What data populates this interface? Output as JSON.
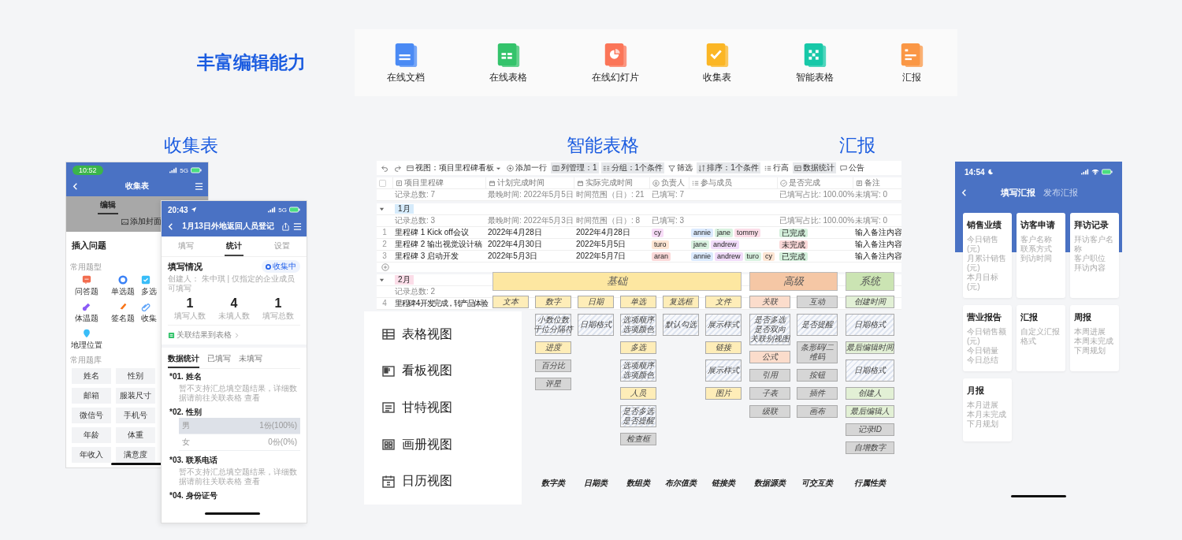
{
  "headline": "丰富编辑能力",
  "apps": [
    {
      "label": "在线文档",
      "kind": "doc"
    },
    {
      "label": "在线表格",
      "kind": "sheet"
    },
    {
      "label": "在线幻灯片",
      "kind": "slide"
    },
    {
      "label": "收集表",
      "kind": "form"
    },
    {
      "label": "智能表格",
      "kind": "smart"
    },
    {
      "label": "汇报",
      "kind": "report"
    }
  ],
  "section_titles": [
    "收集表",
    "智能表格",
    "汇报"
  ],
  "editor_phone": {
    "time": "10:52",
    "network": "5G",
    "title": "收集表",
    "tabs": [
      {
        "label": "编辑",
        "selected": true
      }
    ],
    "cover_hint": "添加封面",
    "sheet_title": "插入问题",
    "types_heading": "常用题型",
    "types": [
      {
        "label": "问答题",
        "kind": "text"
      },
      {
        "label": "单选题",
        "kind": "radio"
      },
      {
        "label": "多选",
        "kind": "check"
      },
      {
        "label": "体温题",
        "kind": "temp"
      },
      {
        "label": "签名题",
        "kind": "sign"
      },
      {
        "label": "收集",
        "kind": "clip"
      },
      {
        "label": "地理位置",
        "kind": "location"
      }
    ],
    "library_heading": "常用题库",
    "library": [
      "姓名",
      "性别",
      "邮箱",
      "服装尺寸",
      "微信号",
      "手机号",
      "年龄",
      "体重",
      "年收入",
      "满意度"
    ]
  },
  "stats_phone": {
    "time": "20:43",
    "network": "5G",
    "title": "1月13日外地返回人员登记",
    "tabs": [
      {
        "label": "填写",
        "selected": false
      },
      {
        "label": "统计",
        "selected": true
      },
      {
        "label": "设置",
        "selected": false
      }
    ],
    "status_heading": "填写情况",
    "status_badge": "收集中",
    "creator": "创建人： 朱中琪 | 仅指定的企业成员可填写",
    "stats": [
      {
        "value": "1",
        "label": "填写人数"
      },
      {
        "value": "4",
        "label": "未填人数"
      },
      {
        "value": "1",
        "label": "填写总数"
      }
    ],
    "link_label": "关联结果到表格",
    "subtabs": [
      {
        "label": "数据统计",
        "selected": true
      },
      {
        "label": "已填写",
        "selected": false
      },
      {
        "label": "未填写",
        "selected": false
      }
    ],
    "questions": [
      {
        "title": "*01. 姓名",
        "kind": "text",
        "note": "暂不支持汇总填空题结果，详细数据请前往关联表格 查看"
      },
      {
        "title": "*02. 性别",
        "kind": "choice",
        "options": [
          {
            "label": "男",
            "count": "1份(100%)",
            "level": 1
          },
          {
            "label": "女",
            "count": "0份(0%)",
            "level": 0
          }
        ]
      },
      {
        "title": "*03. 联系电话",
        "kind": "text",
        "note": "暂不支持汇总填空题结果，详细数据请前往关联表格 查看"
      },
      {
        "title": "*04. 身份证号",
        "kind": "text"
      }
    ]
  },
  "table": {
    "toolbar": [
      {
        "kind": "undo",
        "active": false
      },
      {
        "kind": "redo",
        "active": false
      },
      {
        "label": "视图：项目里程碑看板",
        "kind": "view",
        "active": false
      },
      {
        "label": "添加一行",
        "kind": "add",
        "active": false
      },
      {
        "label": "列管理：1",
        "kind": "columns",
        "active": true
      },
      {
        "label": "分组：1个条件",
        "kind": "group",
        "active": true
      },
      {
        "label": "筛选",
        "kind": "filter",
        "active": false
      },
      {
        "label": "排序：1个条件",
        "kind": "sort",
        "active": true
      },
      {
        "label": "行高",
        "kind": "rowheight",
        "active": false
      },
      {
        "label": "数据统计",
        "kind": "stats",
        "active": true
      },
      {
        "label": "公告",
        "kind": "notice",
        "active": false
      }
    ],
    "all_selected": false,
    "columns": [
      "项目里程碑",
      "计划完成时间",
      "实际完成时间",
      "负责人",
      "参与成员",
      "是否完成",
      "备注"
    ],
    "summary": [
      {
        "kind": "count",
        "text": "记录总数: 7"
      },
      {
        "kind": "latest",
        "text": "最晚时间: 2022年5月5日"
      },
      {
        "kind": "range",
        "text": "时间范围（日）: 21"
      },
      {
        "kind": "filled",
        "text": "已填写: 7"
      },
      {
        "kind": "ratio",
        "text": "已填写占比: 100.00%"
      },
      {
        "kind": "unfilled",
        "text": "未填写: 0"
      }
    ],
    "groups": [
      {
        "label": "1月",
        "color": "#d6ebfb",
        "expanded": true,
        "summary": [
          {
            "kind": "count",
            "text": "记录总数: 3"
          },
          {
            "kind": "latest",
            "text": "最晚时间: 2022年5月3日"
          },
          {
            "kind": "range",
            "text": "时间范围（日）: 8"
          },
          {
            "kind": "filled",
            "text": "已填写: 3"
          },
          {
            "kind": "ratio",
            "text": "已填写占比: 100.00%"
          },
          {
            "kind": "unfilled",
            "text": "未填写: 0"
          }
        ],
        "rows": [
          {
            "index": "1",
            "name": "里程碑 1 Kick off会议",
            "plan": "2022年4月28日",
            "actual": "2022年4月28日",
            "owner": {
              "name": "cy",
              "color": "#f7dcf7"
            },
            "members": [
              {
                "name": "annie",
                "color": "#dbeafe"
              },
              {
                "name": "jane",
                "color": "#d9f2e0"
              },
              {
                "name": "tommy",
                "color": "#fbdde8"
              }
            ],
            "done": {
              "label": "已完成",
              "color": "#d4f0dc"
            },
            "note": "输入备注内容"
          },
          {
            "index": "2",
            "name": "里程碑 2 输出视觉设计稿",
            "plan": "2022年4月30日",
            "actual": "2022年5月5日",
            "owner": {
              "name": "turo",
              "color": "#fde5d3"
            },
            "members": [
              {
                "name": "jane",
                "color": "#d9f2e0"
              },
              {
                "name": "andrew",
                "color": "#f1dcfa"
              }
            ],
            "done": {
              "label": "未完成",
              "color": "#fbd9d9"
            },
            "note": "输入备注内容"
          },
          {
            "index": "3",
            "name": "里程碑 3 启动开发",
            "plan": "2022年5月3日",
            "actual": "2022年5月7日",
            "owner": {
              "name": "aran",
              "color": "#fbd9d9"
            },
            "members": [
              {
                "name": "annie",
                "color": "#dbeafe"
              },
              {
                "name": "andrew",
                "color": "#f1dcfa"
              },
              {
                "name": "turo",
                "color": "#d9f2e0"
              },
              {
                "name": "cy",
                "color": "#fde5d3"
              }
            ],
            "done": {
              "label": "已完成",
              "color": "#d4f0dc"
            },
            "note": "输入备注内容"
          }
        ]
      },
      {
        "label": "2月",
        "color": "#fbdde8",
        "expanded": true,
        "summary": [
          {
            "kind": "count",
            "text": "记录总数: 2"
          }
        ],
        "rows": [
          {
            "index": "4",
            "name": "里程碑 4 开发完成，转产品体验"
          }
        ]
      }
    ]
  },
  "diagram": {
    "groups": [
      {
        "label": "基础",
        "kind": "basic",
        "columns": [
          {
            "items": [
              {
                "text": "文本",
                "kind": "type"
              }
            ]
          },
          {
            "category": "数字类",
            "items": [
              {
                "text": "数字",
                "kind": "type"
              },
              {
                "lines": [
                  "小数位数",
                  "千位分隔符"
                ],
                "kind": "attr"
              },
              {
                "text": "进度",
                "kind": "type"
              },
              {
                "text": "百分比",
                "kind": "extra"
              },
              {
                "text": "评星",
                "kind": "extra"
              }
            ]
          },
          {
            "category": "日期类",
            "items": [
              {
                "text": "日期",
                "kind": "type"
              },
              {
                "lines": [
                  "日期格式"
                ],
                "kind": "attr"
              }
            ]
          },
          {
            "category": "数组类",
            "items": [
              {
                "text": "单选",
                "kind": "type"
              },
              {
                "lines": [
                  "选项顺序",
                  "选项颜色"
                ],
                "kind": "attr"
              },
              {
                "text": "多选",
                "kind": "type"
              },
              {
                "lines": [
                  "选项顺序",
                  "选项颜色"
                ],
                "kind": "attr"
              },
              {
                "text": "人员",
                "kind": "type"
              },
              {
                "lines": [
                  "是否多选",
                  "是否提醒"
                ],
                "kind": "attr"
              },
              {
                "text": "检查框",
                "kind": "extra"
              }
            ]
          },
          {
            "category": "布尔值类",
            "items": [
              {
                "text": "复选框",
                "kind": "type"
              },
              {
                "lines": [
                  "默认勾选"
                ],
                "kind": "attr"
              }
            ]
          },
          {
            "category": "链接类",
            "items": [
              {
                "text": "文件",
                "kind": "type"
              },
              {
                "lines": [
                  "展示样式"
                ],
                "kind": "attr"
              },
              {
                "text": "链接",
                "kind": "type"
              },
              {
                "lines": [
                  "展示样式"
                ],
                "kind": "attr"
              },
              {
                "text": "图片",
                "kind": "type"
              }
            ]
          }
        ]
      },
      {
        "label": "高级",
        "kind": "advanced",
        "columns": [
          {
            "category": "数据源类",
            "items": [
              {
                "text": "关联",
                "kind": "type"
              },
              {
                "lines": [
                  "是否多选",
                  "是否双向",
                  "关联别视图"
                ],
                "kind": "attr"
              },
              {
                "text": "公式",
                "kind": "type"
              },
              {
                "text": "引用",
                "kind": "extra"
              },
              {
                "text": "子表",
                "kind": "extra"
              },
              {
                "text": "级联",
                "kind": "extra"
              }
            ]
          },
          {
            "category": "可交互类",
            "items": [
              {
                "text": "互动",
                "kind": "extra"
              },
              {
                "lines": [
                  "是否提醒"
                ],
                "kind": "attr"
              },
              {
                "text": "条形码/二维码",
                "kind": "extra"
              },
              {
                "text": "按钮",
                "kind": "extra"
              },
              {
                "text": "插件",
                "kind": "extra"
              },
              {
                "text": "画布",
                "kind": "extra"
              }
            ]
          }
        ]
      },
      {
        "label": "系统",
        "kind": "system",
        "columns": [
          {
            "category": "行属性类",
            "items": [
              {
                "text": "创建时间",
                "kind": "type"
              },
              {
                "lines": [
                  "日期格式"
                ],
                "kind": "attr"
              },
              {
                "text": "最后编辑时间",
                "kind": "type"
              },
              {
                "lines": [
                  "日期格式"
                ],
                "kind": "attr"
              },
              {
                "text": "创建人",
                "kind": "type"
              },
              {
                "text": "最后编辑人",
                "kind": "type"
              },
              {
                "text": "记录ID",
                "kind": "extra"
              },
              {
                "text": "自增数字",
                "kind": "extra"
              }
            ]
          }
        ]
      }
    ]
  },
  "views": [
    {
      "label": "表格视图",
      "kind": "table"
    },
    {
      "label": "看板视图",
      "kind": "kanban"
    },
    {
      "label": "甘特视图",
      "kind": "gantt"
    },
    {
      "label": "画册视图",
      "kind": "gallery"
    },
    {
      "label": "日历视图",
      "kind": "calendar"
    }
  ],
  "report_phone": {
    "time": "14:54",
    "tabs": [
      {
        "label": "填写汇报",
        "selected": true
      },
      {
        "label": "发布汇报",
        "selected": false
      }
    ],
    "cards": [
      {
        "title": "销售业绩",
        "fields": [
          "今日销售 (元)",
          "月累计销售 (元)",
          "本月目标 (元)"
        ]
      },
      {
        "title": "访客申请",
        "fields": [
          "客户名称",
          "联系方式",
          "到访时间"
        ]
      },
      {
        "title": "拜访记录",
        "fields": [
          "拜访客户名称",
          "客户职位",
          "拜访内容"
        ]
      },
      {
        "title": "营业报告",
        "fields": [
          "今日销售额 (元)",
          "今日销量",
          "今日总结"
        ]
      },
      {
        "title": "汇报",
        "fields": [
          "自定义汇报格式"
        ]
      },
      {
        "title": "周报",
        "fields": [
          "本周进展",
          "本周未完成",
          "下周规划"
        ]
      },
      {
        "title": "月报",
        "fields": [
          "本月进展",
          "本月未完成",
          "下月规划"
        ]
      }
    ]
  }
}
